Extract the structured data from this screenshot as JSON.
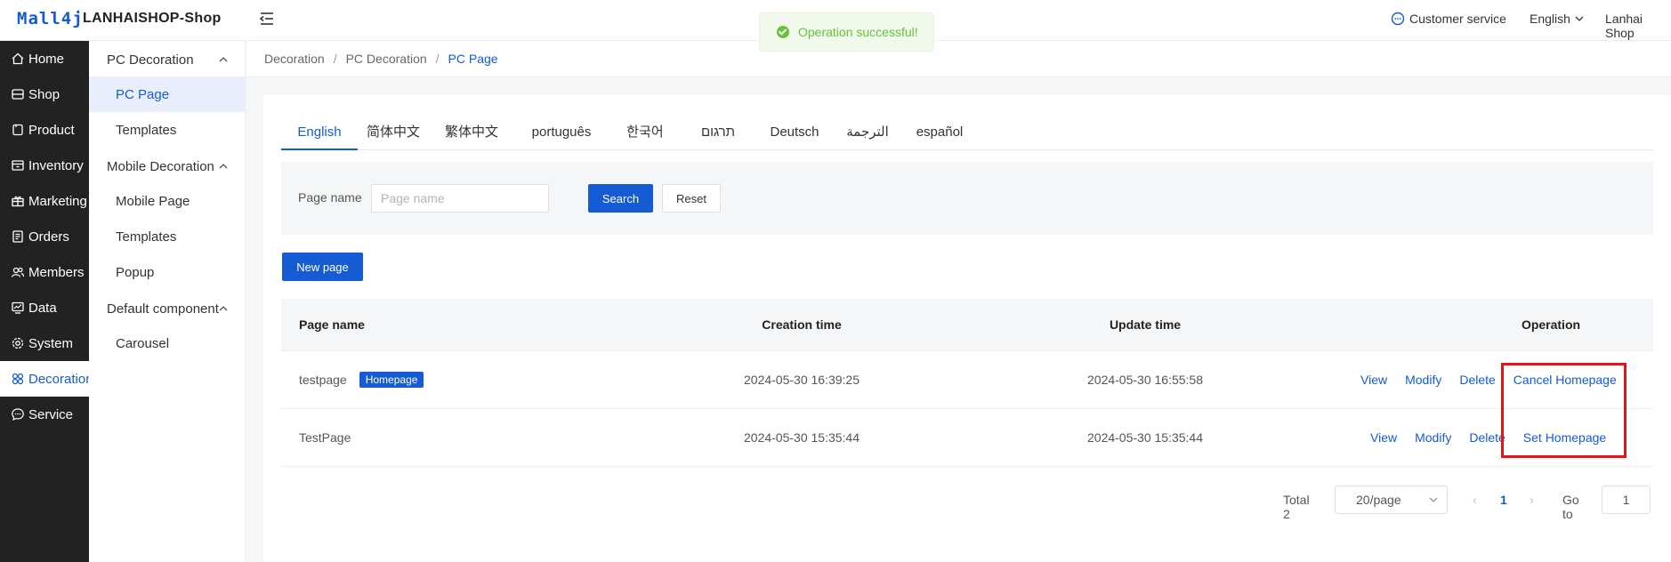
{
  "header": {
    "logo_text": "Mall4j",
    "shop_name": "LANHAISHOP-Shop",
    "customer_service": "Customer service",
    "language": "English",
    "user": "Lanhai Shop"
  },
  "toast": {
    "message": "Operation successful!"
  },
  "sidebar": {
    "items": [
      {
        "label": "Home",
        "icon": "home-icon"
      },
      {
        "label": "Shop",
        "icon": "shop-icon"
      },
      {
        "label": "Product",
        "icon": "product-icon"
      },
      {
        "label": "Inventory",
        "icon": "inventory-icon"
      },
      {
        "label": "Marketing",
        "icon": "gift-icon"
      },
      {
        "label": "Orders",
        "icon": "orders-icon"
      },
      {
        "label": "Members",
        "icon": "members-icon"
      },
      {
        "label": "Data",
        "icon": "data-icon"
      },
      {
        "label": "System",
        "icon": "gear-icon"
      },
      {
        "label": "Decoration",
        "icon": "decoration-icon",
        "active": true
      },
      {
        "label": "Service",
        "icon": "chat-icon"
      }
    ]
  },
  "subnav": {
    "groups": [
      {
        "label": "PC Decoration",
        "items": [
          "PC Page",
          "Templates"
        ]
      },
      {
        "label": "Mobile Decoration",
        "items": [
          "Mobile Page",
          "Templates",
          "Popup"
        ]
      },
      {
        "label": "Default component",
        "items": [
          "Carousel"
        ]
      }
    ],
    "active_item": "PC Page"
  },
  "breadcrumb": [
    "Decoration",
    "PC Decoration",
    "PC Page"
  ],
  "tabs": [
    "English",
    "简体中文",
    "繁体中文",
    "português",
    "한국어",
    "תרגום",
    "Deutsch",
    "الترجمة",
    "español"
  ],
  "active_tab": "English",
  "search": {
    "label": "Page name",
    "placeholder": "Page name",
    "value": "",
    "search_button": "Search",
    "reset_button": "Reset"
  },
  "new_page_button": "New page",
  "table": {
    "columns": [
      "Page name",
      "Creation time",
      "Update time",
      "Operation"
    ],
    "rows": [
      {
        "name": "testpage",
        "badge": "Homepage",
        "created": "2024-05-30 16:39:25",
        "updated": "2024-05-30 16:55:58",
        "ops": [
          "View",
          "Modify",
          "Delete",
          "Cancel Homepage"
        ]
      },
      {
        "name": "TestPage",
        "badge": "",
        "created": "2024-05-30 15:35:44",
        "updated": "2024-05-30 15:35:44",
        "ops": [
          "View",
          "Modify",
          "Delete",
          "Set Homepage"
        ]
      }
    ]
  },
  "pagination": {
    "total_label": "Total 2",
    "page_size": "20/page",
    "current_page": "1",
    "goto_label": "Go to",
    "goto_value": "1"
  },
  "colors": {
    "primary": "#155bd4",
    "sidebar_bg": "#222222",
    "success": "#67c23a",
    "highlight": "#e5141b"
  }
}
